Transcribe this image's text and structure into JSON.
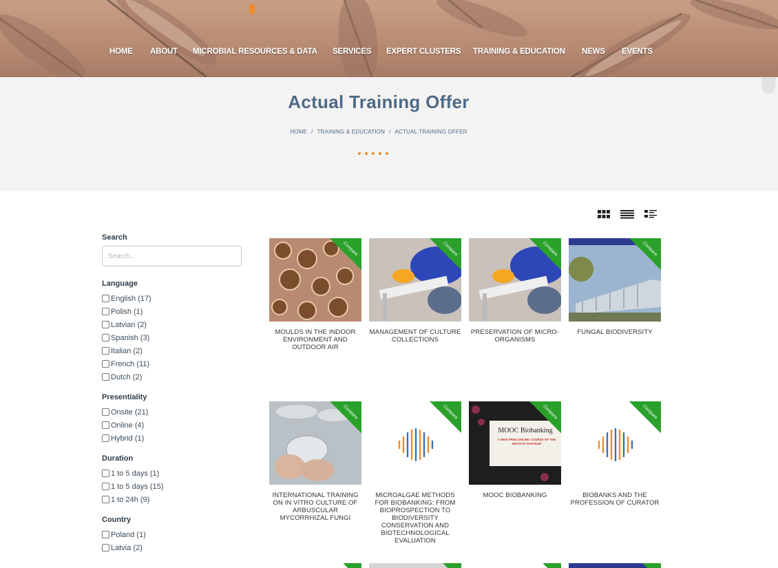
{
  "nav": {
    "items": [
      "HOME",
      "ABOUT",
      "MICROBIAL RESOURCES & DATA",
      "SERVICES",
      "EXPERT CLUSTERS",
      "TRAINING & EDUCATION",
      "NEWS",
      "EVENTS"
    ]
  },
  "page": {
    "title": "Actual Training Offer",
    "breadcrumb": [
      "HOME",
      "TRAINING & EDUCATION",
      "ACTUAL TRAINING OFFER"
    ],
    "breadcrumb_sep": "/"
  },
  "view_icons": [
    "grid-view-icon",
    "list-view-icon",
    "detail-list-view-icon"
  ],
  "sidebar": {
    "search": {
      "title": "Search",
      "placeholder": "Search..."
    },
    "groups": [
      {
        "title": "Language",
        "options": [
          "English (17)",
          "Polish (1)",
          "Latvian (2)",
          "Spanish (3)",
          "Italian (2)",
          "French (11)",
          "Dutch (2)"
        ]
      },
      {
        "title": "Presentiality",
        "options": [
          "Onsite (21)",
          "Online (4)",
          "Hybrid (1)"
        ]
      },
      {
        "title": "Duration",
        "options": [
          "1 to 5 days (1)",
          "1 to 5 days (15)",
          "1 to 24h (9)"
        ]
      },
      {
        "title": "Country",
        "options": [
          "Poland (1)",
          "Latvia (2)"
        ]
      }
    ]
  },
  "compare_label": "Compare",
  "courses": [
    {
      "title": "MOULDS IN THE INDOOR ENVIRONMENT AND OUTDOOR AIR"
    },
    {
      "title": "MANAGEMENT OF CULTURE COLLECTIONS"
    },
    {
      "title": "PRESERVATION OF MICRO-ORGANISMS"
    },
    {
      "title": "FUNGAL BIODIVERSITY"
    },
    {
      "title": "INTERNATIONAL TRAINING ON IN VITRO CULTURE OF ARBUSCULAR MYCORRHIZAL FUNGI"
    },
    {
      "title": "MICROALGAE METHODS FOR BIOBANKING: FROM BIOPROSPECTION TO BIODIVERSITY CONSERVATION AND BIOTECHNOLOGICAL EVALUATION"
    },
    {
      "title": "MOOC BIOBANKING",
      "poster_title": "MOOC Biobanking",
      "poster_sub": "A NEW FREE ONLINE COURSE OF THE INSTITUT PASTEUR"
    },
    {
      "title": "BIOBANKS AND THE PROFESSION OF CURATOR"
    }
  ],
  "colors": {
    "accent": "#f08a2a",
    "title": "#4e6a85",
    "ribbon": "#2aa12a"
  }
}
